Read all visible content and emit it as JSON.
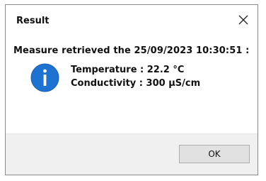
{
  "dialog": {
    "title": "Result",
    "close_icon": "close-icon",
    "message": "Measure retrieved the 25/09/2023 10:30:51 :",
    "icon": "info-icon",
    "icon_color": "#1e73d2",
    "details": [
      "Temperature : 22.2 °C",
      "Conductivity : 300 µS/cm"
    ],
    "ok_label": "OK"
  }
}
